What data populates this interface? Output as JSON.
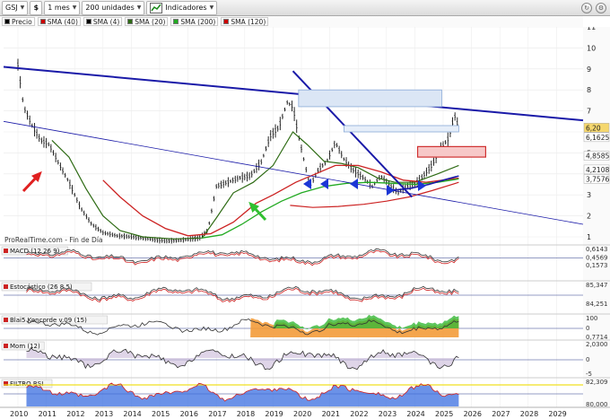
{
  "toolbar": {
    "symbol": "GSJ",
    "timeframe": "1 mes",
    "units": "200 unidades",
    "indicators_label": "Indicadores"
  },
  "legend": [
    {
      "label": "Precio",
      "color": "#000000"
    },
    {
      "label": "SMA (40)",
      "color": "#cc0000"
    },
    {
      "label": "SMA (4)",
      "color": "#000000"
    },
    {
      "label": "SMA (20)",
      "color": "#2e6b14"
    },
    {
      "label": "SMA (200)",
      "color": "#22aa22"
    },
    {
      "label": "SMA (120)",
      "color": "#cc0000"
    }
  ],
  "watermark": "ProRealTime.com - Fin de Día",
  "price_axis": {
    "ticks": [
      "11",
      "10",
      "9",
      "8",
      "7",
      "6",
      "5",
      "4",
      "3",
      "2",
      "1"
    ],
    "labels": [
      {
        "text": "6,20",
        "bg": "#f5d76e"
      },
      {
        "text": "6,1625",
        "bg": "#ffffff"
      },
      {
        "text": "4,8585",
        "bg": "#ffffff"
      },
      {
        "text": "4,2108",
        "bg": "#ffffff"
      },
      {
        "text": "3,7576",
        "bg": "#ffffff"
      }
    ]
  },
  "panels": [
    {
      "title": "MACD (12 26 9)",
      "axis": [
        "0,6143",
        "0,4569",
        "0,1573"
      ]
    },
    {
      "title": "Estocástico (26 8 5)",
      "axis": [
        "85,347",
        "84,251"
      ]
    },
    {
      "title": "Blai5 Koncorde v.09 (15)",
      "axis": [
        "100",
        "0",
        "0,7714"
      ]
    },
    {
      "title": "Mom (12)",
      "axis": [
        "2,0300",
        "0",
        "-5"
      ]
    },
    {
      "title": "FILTRO RSI",
      "axis": [
        "82,309",
        "80,000"
      ]
    }
  ],
  "x_axis": [
    "2010",
    "2011",
    "2012",
    "2013",
    "2014",
    "2015",
    "2016",
    "2017",
    "2018",
    "2019",
    "2020",
    "2021",
    "2022",
    "2023",
    "2024",
    "2025",
    "2026",
    "2027",
    "2028",
    "2029"
  ],
  "colors": {
    "trendline": "#1a1aa8",
    "sma_green": "#22aa22",
    "sma_red": "#cc2222",
    "sma_dark": "#2e6b14",
    "price": "#111111",
    "arrow_blue": "#1b36d6",
    "arrow_red": "#e02020",
    "arrow_green": "#30c030"
  }
}
